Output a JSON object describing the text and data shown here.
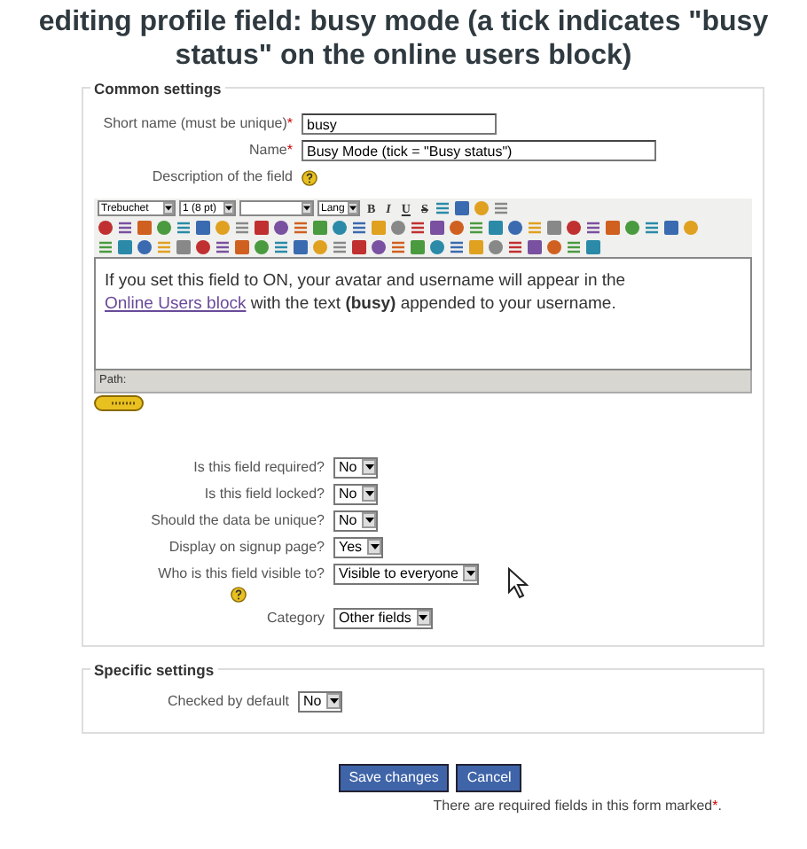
{
  "title": "editing profile field: busy mode (a tick indicates \"busy status\" on the online users block)",
  "common": {
    "legend": "Common settings",
    "fields": [
      {
        "label": "Short name (must be unique)",
        "required": true,
        "value": "busy",
        "kind": "text"
      },
      {
        "label": "Name",
        "required": true,
        "value": "Busy Mode (tick = \"Busy status\")",
        "kind": "text"
      }
    ],
    "description_label": "Description of the field",
    "editor": {
      "selects": [
        {
          "kind": "select",
          "value": "Trebuchet"
        },
        {
          "kind": "select",
          "value": "1 (8 pt)"
        },
        {
          "kind": "blank"
        },
        {
          "kind": "select",
          "value": "Lang"
        }
      ],
      "format_buttons": [
        "B",
        "I",
        "U",
        "S"
      ],
      "text": "If you set this field to ON, your avatar and username will appear in the ",
      "link": "Online Users block",
      "text_after": " with the text **(busy)** appended to your username.",
      "path_label": "Path:"
    },
    "options": [
      {
        "label": "Is this field required?",
        "value": "No"
      },
      {
        "label": "Is this field locked?",
        "value": "No"
      },
      {
        "label": "Should the data be unique?",
        "value": "No"
      },
      {
        "label": "Display on signup page?",
        "value": "Yes"
      },
      {
        "label": "Who is this field visible to?",
        "value": "Visible to everyone",
        "help": true
      },
      {
        "label": "Category",
        "value": "Other fields"
      }
    ]
  },
  "specific": {
    "legend": "Specific settings",
    "options": [
      {
        "label": "Checked by default",
        "value": "No"
      }
    ]
  },
  "buttons": [
    "Save changes",
    "Cancel"
  ],
  "required_note": "There are required fields in this form marked",
  "required_mark": "*",
  "note_end": "."
}
